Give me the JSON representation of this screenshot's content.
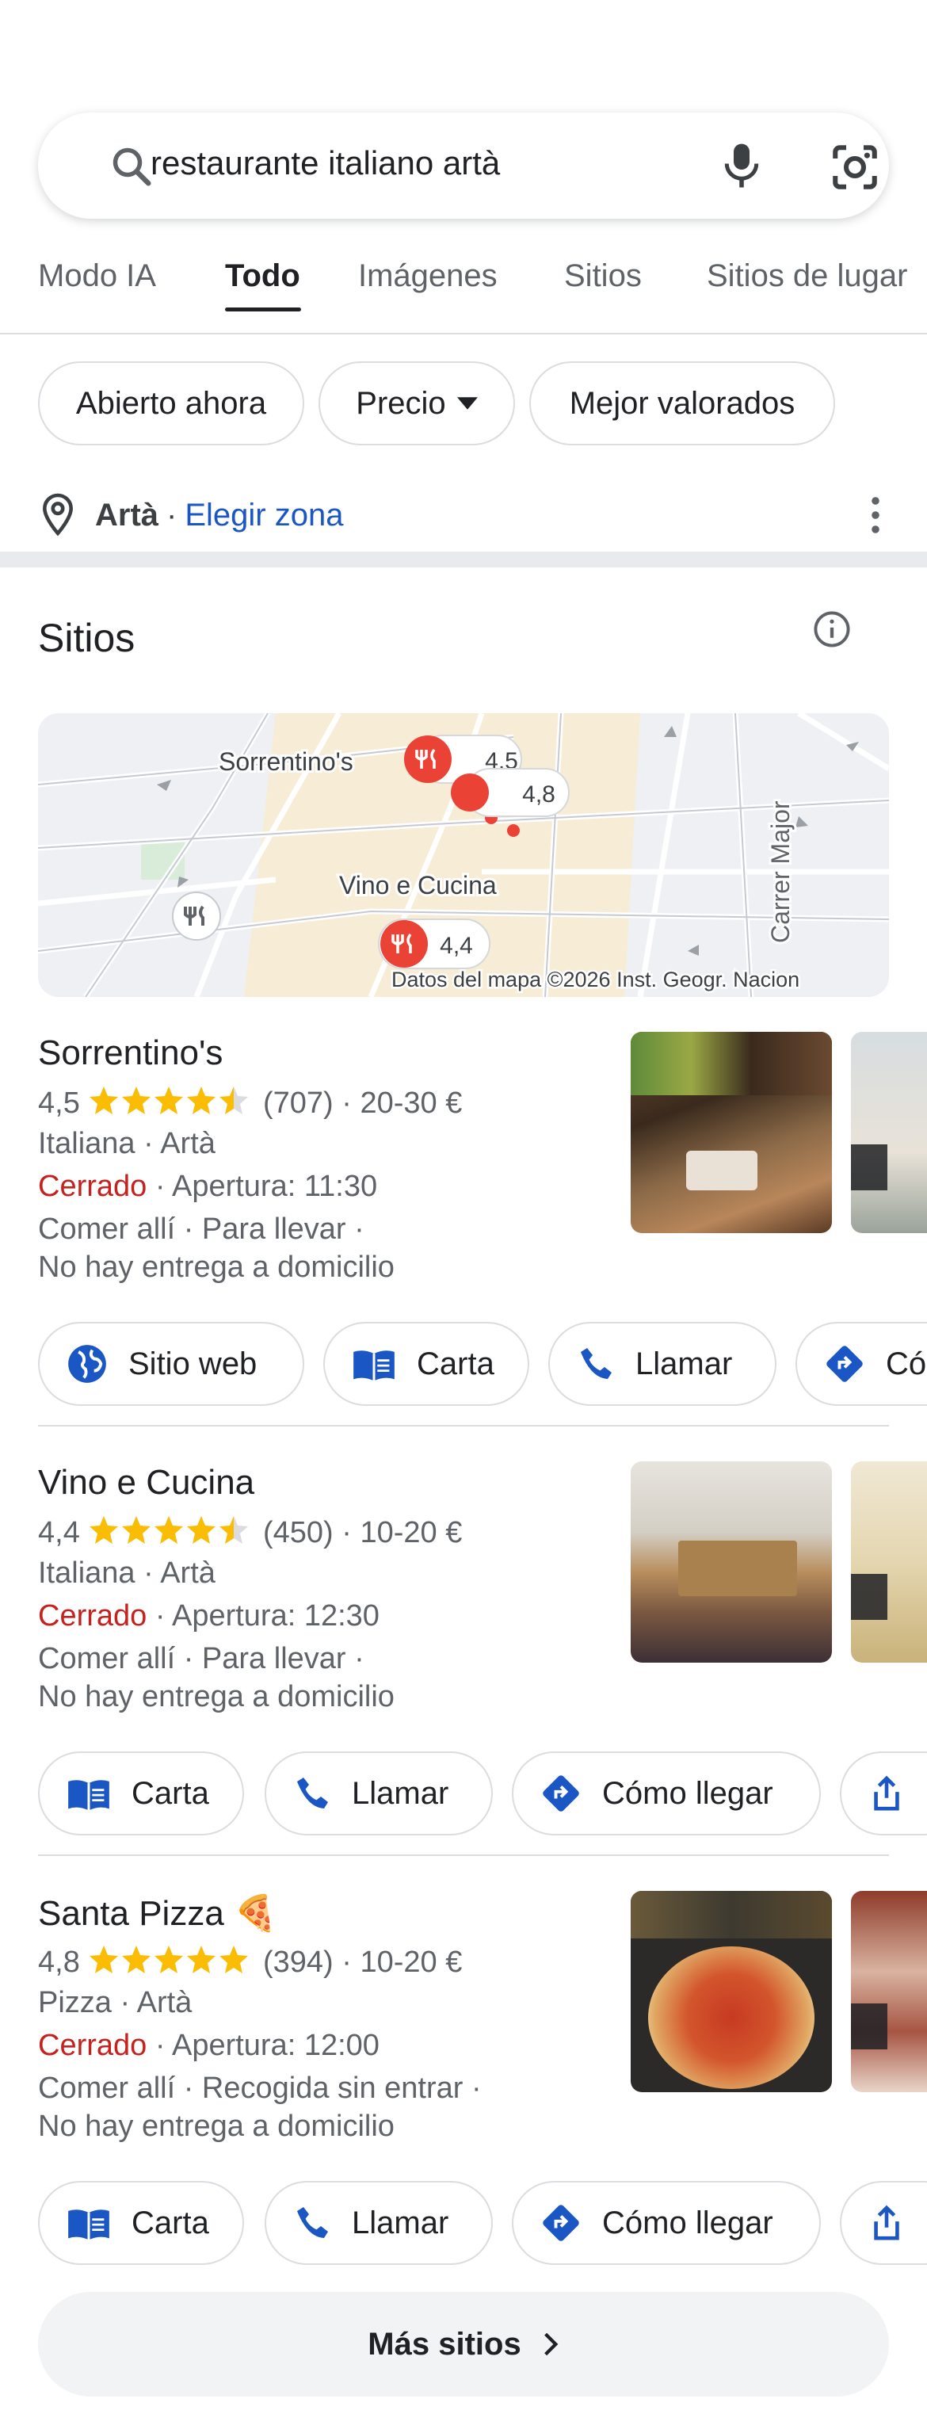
{
  "search": {
    "query": "restaurante italiano artà"
  },
  "tabs": [
    "Modo IA",
    "Todo",
    "Imágenes",
    "Sitios",
    "Sitios de lugar"
  ],
  "active_tab": "Todo",
  "chips": [
    "Abierto ahora",
    "Precio",
    "Mejor valorados"
  ],
  "location": {
    "place": "Artà",
    "separator": "·",
    "change_label": "Elegir zona"
  },
  "section": {
    "title": "Sitios"
  },
  "map": {
    "labels": [
      "Sorrentino's",
      "Vino e Cucina",
      "Carrer Major"
    ],
    "pins": [
      "4,5",
      "4,8",
      "4,4"
    ],
    "attribution": "Datos del mapa ©2026 Inst. Geogr. Nacion"
  },
  "listings": [
    {
      "name": "Sorrentino's",
      "rating": "4,5",
      "reviews": "(707)",
      "price": "· 20-30 €",
      "category": "Italiana · Artà",
      "status": "Cerrado",
      "opening": "· Apertura: 11:30",
      "services_1": "Comer allí · Para llevar ·",
      "services_2": "No hay entrega a domicilio",
      "buttons": [
        "Sitio web",
        "Carta",
        "Llamar",
        "Có"
      ]
    },
    {
      "name": "Vino e Cucina",
      "rating": "4,4",
      "reviews": "(450)",
      "price": "· 10-20 €",
      "category": "Italiana · Artà",
      "status": "Cerrado",
      "opening": "· Apertura: 12:30",
      "services_1": "Comer allí · Para llevar ·",
      "services_2": "No hay entrega a domicilio",
      "buttons": [
        "Carta",
        "Llamar",
        "Cómo llegar"
      ]
    },
    {
      "name": "Santa Pizza 🍕",
      "rating": "4,8",
      "reviews": "(394)",
      "price": "· 10-20 €",
      "category": "Pizza · Artà",
      "status": "Cerrado",
      "opening": "· Apertura: 12:00",
      "services_1": "Comer allí · Recogida sin entrar ·",
      "services_2": "No hay entrega a domicilio",
      "buttons": [
        "Carta",
        "Llamar",
        "Cómo llegar"
      ]
    }
  ],
  "more_button": "Más sitios",
  "colors": {
    "accent_blue": "#1a56c4",
    "closed_red": "#c5221f",
    "star": "#fbbc04",
    "pin_red": "#ea4335"
  },
  "icons": [
    "search-icon",
    "mic-icon",
    "lens-icon",
    "location-pin-icon",
    "more-vert-icon",
    "info-icon",
    "globe-icon",
    "menu-book-icon",
    "phone-icon",
    "directions-icon",
    "share-icon",
    "chevron-right-icon",
    "restaurant-icon",
    "play-icon"
  ]
}
